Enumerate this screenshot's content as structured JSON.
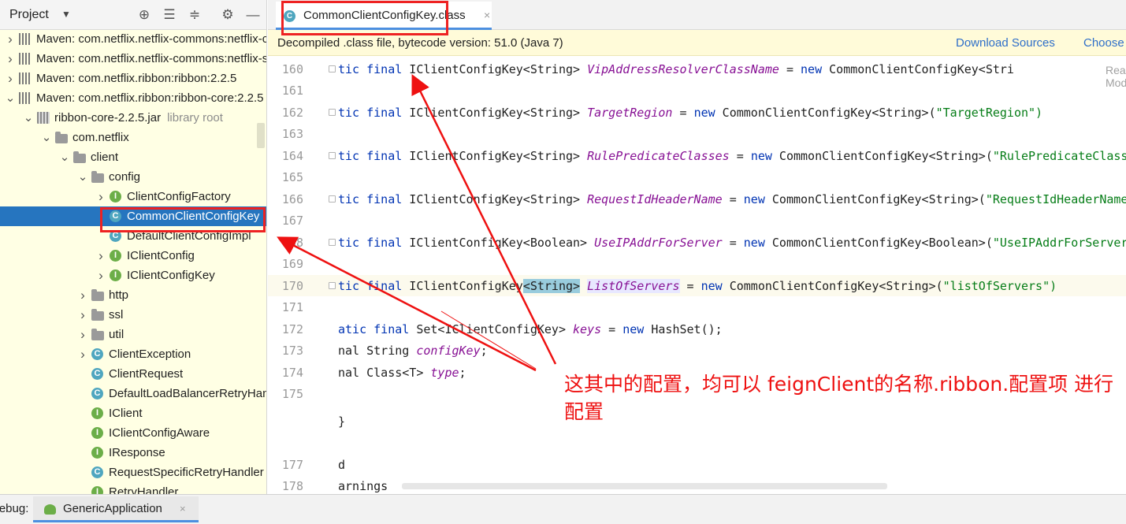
{
  "project": {
    "title": "Project",
    "tree": [
      {
        "label": "Maven: com.netflix.netflix-commons:netflix-commons-util",
        "icon": "maven",
        "arrow": "right",
        "depth": 0
      },
      {
        "label": "Maven: com.netflix.netflix-commons:netflix-statistics",
        "icon": "maven",
        "arrow": "right",
        "depth": 0
      },
      {
        "label": "Maven: com.netflix.ribbon:ribbon:2.2.5",
        "icon": "maven",
        "arrow": "right",
        "depth": 0
      },
      {
        "label": "Maven: com.netflix.ribbon:ribbon-core:2.2.5",
        "icon": "maven",
        "arrow": "down",
        "depth": 0
      },
      {
        "label": "ribbon-core-2.2.5.jar",
        "sub": "library root",
        "icon": "jar",
        "arrow": "down",
        "depth": 1
      },
      {
        "label": "com.netflix",
        "icon": "folder",
        "arrow": "down",
        "depth": 2
      },
      {
        "label": "client",
        "icon": "folder",
        "arrow": "down",
        "depth": 3
      },
      {
        "label": "config",
        "icon": "folder",
        "arrow": "down",
        "depth": 4
      },
      {
        "label": "ClientConfigFactory",
        "icon": "I",
        "arrow": "right",
        "depth": 5
      },
      {
        "label": "CommonClientConfigKey",
        "icon": "C",
        "arrow": "",
        "depth": 5,
        "selected": true
      },
      {
        "label": "DefaultClientConfigImpl",
        "icon": "C",
        "arrow": "",
        "depth": 5
      },
      {
        "label": "IClientConfig",
        "icon": "I",
        "arrow": "right",
        "depth": 5
      },
      {
        "label": "IClientConfigKey",
        "icon": "I",
        "arrow": "right",
        "depth": 5
      },
      {
        "label": "http",
        "icon": "folder",
        "arrow": "right",
        "depth": 4
      },
      {
        "label": "ssl",
        "icon": "folder",
        "arrow": "right",
        "depth": 4
      },
      {
        "label": "util",
        "icon": "folder",
        "arrow": "right",
        "depth": 4
      },
      {
        "label": "ClientException",
        "icon": "C",
        "arrow": "right",
        "depth": 4
      },
      {
        "label": "ClientRequest",
        "icon": "C",
        "arrow": "",
        "depth": 4
      },
      {
        "label": "DefaultLoadBalancerRetryHandler",
        "icon": "C",
        "arrow": "",
        "depth": 4
      },
      {
        "label": "IClient",
        "icon": "I",
        "arrow": "",
        "depth": 4
      },
      {
        "label": "IClientConfigAware",
        "icon": "I",
        "arrow": "",
        "depth": 4
      },
      {
        "label": "IResponse",
        "icon": "I",
        "arrow": "",
        "depth": 4
      },
      {
        "label": "RequestSpecificRetryHandler",
        "icon": "C",
        "arrow": "",
        "depth": 4
      },
      {
        "label": "RetryHandler",
        "icon": "I",
        "arrow": "",
        "depth": 4
      }
    ]
  },
  "editor_tab": {
    "label": "CommonClientConfigKey.class",
    "close": "×"
  },
  "banner": {
    "text": "Decompiled .class file, bytecode version: 51.0 (Java 7)",
    "download_sources": "Download Sources",
    "choose_sources": "Choose Sources..."
  },
  "editor": {
    "reader_mode_hint": "Reader Mode",
    "lines": [
      {
        "num": "160",
        "kind": "decl",
        "prefix": "tic final IClientConfigKey<String> ",
        "field": "VipAddressResolverClassName",
        "suffix": " = new CommonClientConfigKey<Stri",
        "str": ""
      },
      {
        "num": "161",
        "kind": "blank"
      },
      {
        "num": "162",
        "kind": "decl",
        "prefix": "tic final IClientConfigKey<String> ",
        "field": "TargetRegion",
        "suffix": " = new CommonClientConfigKey<String>(",
        "str": "\"TargetRegion\")"
      },
      {
        "num": "163",
        "kind": "blank"
      },
      {
        "num": "164",
        "kind": "decl",
        "prefix": "tic final IClientConfigKey<String> ",
        "field": "RulePredicateClasses",
        "suffix": " = new CommonClientConfigKey<String>(",
        "str": "\"RulePredicateClasses\")"
      },
      {
        "num": "165",
        "kind": "blank"
      },
      {
        "num": "166",
        "kind": "decl",
        "prefix": "tic final IClientConfigKey<String> ",
        "field": "RequestIdHeaderName",
        "suffix": " = new CommonClientConfigKey<String>(",
        "str": "\"RequestIdHeaderName\")"
      },
      {
        "num": "167",
        "kind": "blank"
      },
      {
        "num": "168",
        "kind": "decl",
        "prefix": "tic final IClientConfigKey<Boolean> ",
        "field": "UseIPAddrForServer",
        "suffix": " = new CommonClientConfigKey<Boolean>(",
        "str": "\"UseIPAddrForServer\")"
      },
      {
        "num": "169",
        "kind": "blank"
      },
      {
        "num": "170",
        "kind": "current",
        "prefix": "tic final IClientConfigKey",
        "brace": "<String>",
        "field": "ListOfServers",
        "suffix": " = new CommonClientConfigKey<String>(",
        "str": "\"listOfServers\")"
      },
      {
        "num": "171",
        "kind": "blank"
      },
      {
        "num": "172",
        "kind": "keys",
        "text_a": "atic final Set<IClientConfigKey> ",
        "field": "keys",
        "text_b": " = new HashSet();"
      },
      {
        "num": "173",
        "kind": "simple",
        "text_a": "nal String ",
        "field": "configKey",
        "text_b": ";"
      },
      {
        "num": "174",
        "kind": "simple",
        "text_a": "nal Class<T> ",
        "field": "type",
        "text_b": ";"
      },
      {
        "num": "175",
        "kind": "blank"
      },
      {
        "num": "",
        "kind": "plain",
        "text": "}"
      },
      {
        "num": "177",
        "kind": "plain",
        "text": "d"
      },
      {
        "num": "178",
        "kind": "plain",
        "text": "arnings"
      }
    ]
  },
  "debug": {
    "label": "Debug:",
    "tab_label": "GenericApplication",
    "close": "×"
  },
  "annotation": {
    "text": "这其中的配置，均可以 feignClient的名称.ribbon.配置项 进行配置",
    "color": "#ee1111"
  }
}
